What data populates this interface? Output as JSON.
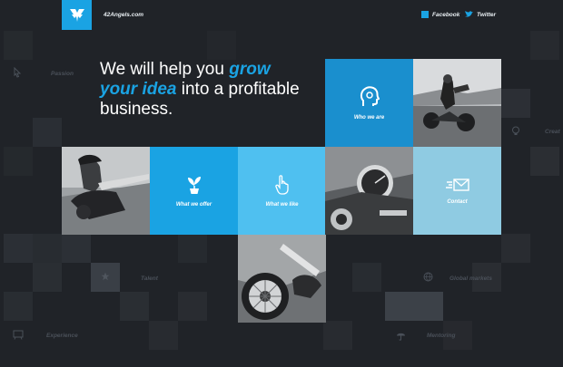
{
  "header": {
    "site_name": "42Angels.com",
    "facebook_label": "Facebook",
    "twitter_label": "Twitter"
  },
  "hero": {
    "line1_pre": "We will help you ",
    "line1_highlight": "grow",
    "line2_highlight": "your idea",
    "line2_post": " into a profitable",
    "line3": "business."
  },
  "tiles": {
    "who_we_are": "Who we are",
    "what_we_offer": "What we offer",
    "what_we_like": "What we like",
    "contact": "Contact"
  },
  "background_labels": {
    "passion": "Passion",
    "creativity": "Creat",
    "talent": "Talent",
    "global_markets": "Global markets",
    "experience": "Experience",
    "mentoring": "Mentoring"
  },
  "colors": {
    "background": "#202328",
    "accent_blue": "#1aa3e3",
    "light_blue": "#4fc0f0",
    "pale_blue": "#8fcbe2",
    "text_white": "#ffffff"
  },
  "icons": [
    "logo-angel-icon",
    "facebook-icon",
    "twitter-bird-icon",
    "head-icon",
    "plant-icon",
    "pointer-hand-icon",
    "envelope-icon",
    "cursor-icon",
    "lightbulb-icon",
    "star-icon",
    "globe-icon",
    "chalkboard-icon",
    "umbrella-icon"
  ]
}
